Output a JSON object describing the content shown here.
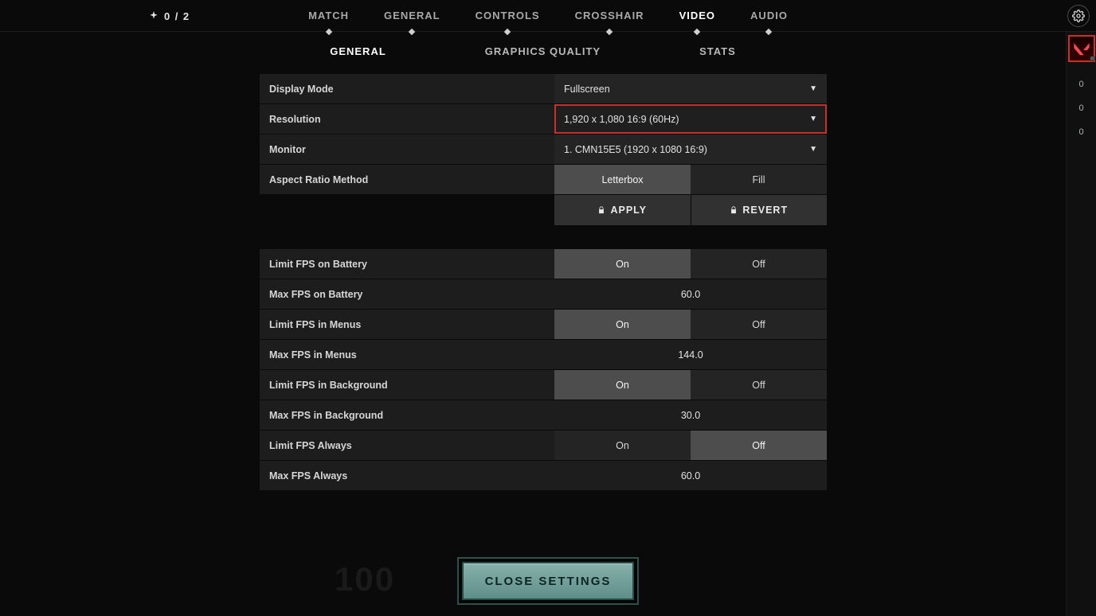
{
  "friends": {
    "current": "0",
    "total": "2"
  },
  "tabs": {
    "primary": [
      "MATCH",
      "GENERAL",
      "CONTROLS",
      "CROSSHAIR",
      "VIDEO",
      "AUDIO"
    ],
    "primary_active": "VIDEO",
    "secondary": [
      "GENERAL",
      "GRAPHICS QUALITY",
      "STATS"
    ],
    "secondary_active": "GENERAL"
  },
  "settings": {
    "display_mode": {
      "label": "Display Mode",
      "value": "Fullscreen"
    },
    "resolution": {
      "label": "Resolution",
      "value": "1,920 x 1,080 16:9 (60Hz)"
    },
    "monitor": {
      "label": "Monitor",
      "value": "1. CMN15E5 (1920 x  1080 16:9)"
    },
    "aspect_ratio": {
      "label": "Aspect Ratio Method",
      "options": [
        "Letterbox",
        "Fill"
      ],
      "selected": "Letterbox"
    },
    "apply_label": "APPLY",
    "revert_label": "REVERT",
    "limit_fps_battery": {
      "label": "Limit FPS on Battery",
      "options": [
        "On",
        "Off"
      ],
      "selected": "On"
    },
    "max_fps_battery": {
      "label": "Max FPS on Battery",
      "value": "60.0"
    },
    "limit_fps_menus": {
      "label": "Limit FPS in Menus",
      "options": [
        "On",
        "Off"
      ],
      "selected": "On"
    },
    "max_fps_menus": {
      "label": "Max FPS in Menus",
      "value": "144.0"
    },
    "limit_fps_background": {
      "label": "Limit FPS in Background",
      "options": [
        "On",
        "Off"
      ],
      "selected": "On"
    },
    "max_fps_background": {
      "label": "Max FPS in Background",
      "value": "30.0"
    },
    "limit_fps_always": {
      "label": "Limit FPS Always",
      "options": [
        "On",
        "Off"
      ],
      "selected": "Off"
    },
    "max_fps_always": {
      "label": "Max FPS Always",
      "value": "60.0"
    }
  },
  "rail": {
    "metrics": [
      "0",
      "0",
      "0"
    ]
  },
  "close_label": "CLOSE SETTINGS",
  "ghost_text": "100"
}
